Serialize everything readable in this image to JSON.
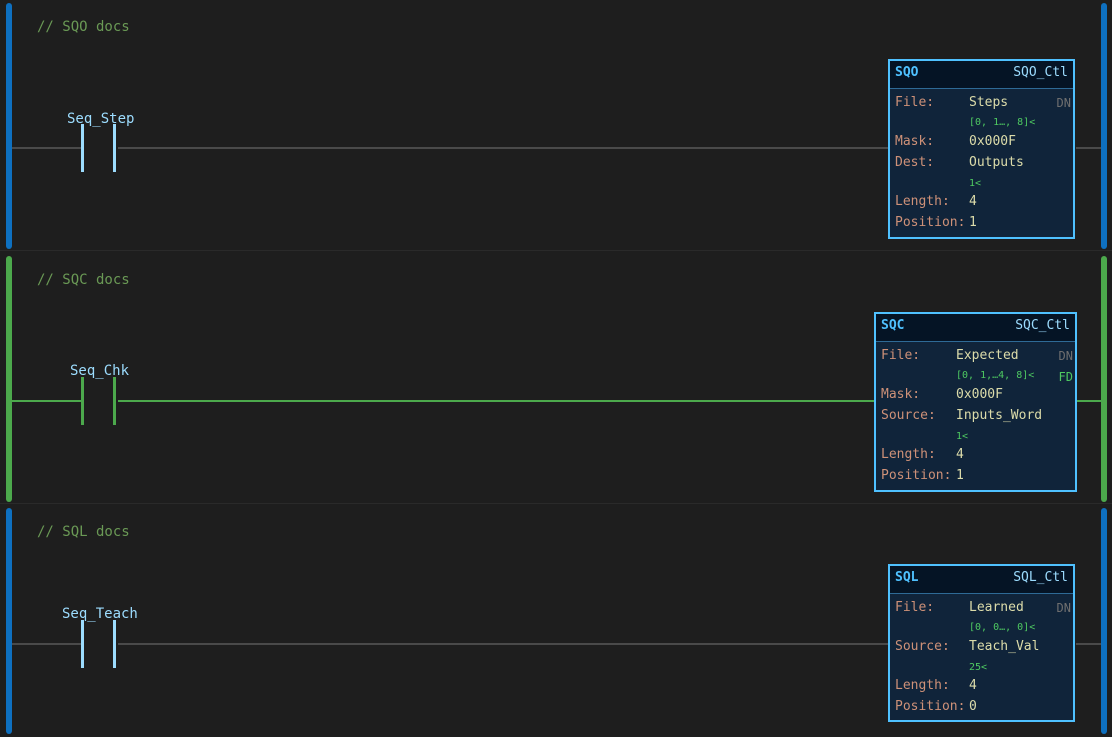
{
  "rungs": [
    {
      "comment": "// SQO docs",
      "rail_color": "#0e70c0",
      "wire_color": "#4a4a4a",
      "contact_color": "#9cdcfe",
      "contact_tag": "Seq_Step",
      "block": {
        "type": "SQO",
        "control": "SQO_Ctl",
        "file_label": "File:",
        "file_value": "Steps",
        "file_sub": "[0, 1…, 8]<",
        "mask_label": "Mask:",
        "mask_value": "0x000F",
        "third_label": "Dest:",
        "third_value": "Outputs",
        "third_sub": "1<",
        "length_label": "Length:",
        "length_value": "4",
        "position_label": "Position:",
        "position_value": "1",
        "flags": [
          {
            "label": "DN",
            "active": false
          }
        ]
      }
    },
    {
      "comment": "// SQC docs",
      "rail_color": "#4ca94c",
      "wire_color": "#4ca94c",
      "contact_color": "#4ca94c",
      "contact_tag": "Seq_Chk",
      "block": {
        "type": "SQC",
        "control": "SQC_Ctl",
        "file_label": "File:",
        "file_value": "Expected",
        "file_sub": "[0, 1,…4, 8]<",
        "mask_label": "Mask:",
        "mask_value": "0x000F",
        "third_label": "Source:",
        "third_value": "Inputs_Word",
        "third_sub": "1<",
        "length_label": "Length:",
        "length_value": "4",
        "position_label": "Position:",
        "position_value": "1",
        "flags": [
          {
            "label": "DN",
            "active": false
          },
          {
            "label": "FD",
            "active": true
          }
        ]
      }
    },
    {
      "comment": "// SQL docs",
      "rail_color": "#0e70c0",
      "wire_color": "#4a4a4a",
      "contact_color": "#9cdcfe",
      "contact_tag": "Seq_Teach",
      "block": {
        "type": "SQL",
        "control": "SQL_Ctl",
        "file_label": "File:",
        "file_value": "Learned",
        "file_sub": "[0, 0…, 0]<",
        "third_label": "Source:",
        "third_value": "Teach_Val",
        "third_sub": "25<",
        "length_label": "Length:",
        "length_value": "4",
        "position_label": "Position:",
        "position_value": "0",
        "flags": [
          {
            "label": "DN",
            "active": false
          }
        ]
      }
    }
  ]
}
